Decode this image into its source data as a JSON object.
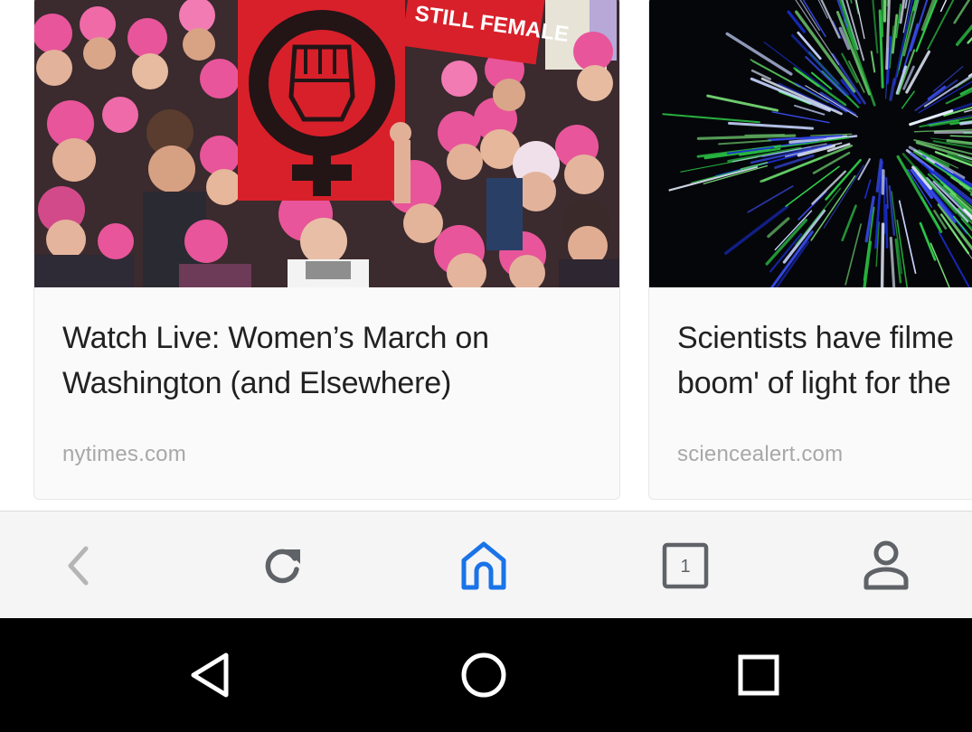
{
  "feed": {
    "cards": [
      {
        "title": "Watch Live: Women’s March on\nWashington (and Elsewhere)",
        "source": "nytimes.com",
        "image": "protest-crowd-photo",
        "sign_text": "STILL FEMALE"
      },
      {
        "title": "Scientists have filme\nboom' of light for the",
        "source": "sciencealert.com",
        "image": "light-speed-streaks-photo"
      }
    ]
  },
  "toolbar": {
    "buttons": [
      {
        "name": "back",
        "icon": "chevron-left-icon"
      },
      {
        "name": "reload",
        "icon": "reload-icon"
      },
      {
        "name": "home",
        "icon": "home-icon",
        "active": true
      },
      {
        "name": "tabs",
        "icon": "tabs-icon",
        "count": "1"
      },
      {
        "name": "profile",
        "icon": "person-icon"
      }
    ]
  },
  "navbar": {
    "buttons": [
      "back-triangle-icon",
      "home-circle-icon",
      "recents-square-icon"
    ]
  },
  "colors": {
    "accent": "#1a73e8",
    "icon": "#5f6368",
    "icon_disabled": "#b5b5b5",
    "text": "#212121",
    "source": "#a8a8a8",
    "sign_red": "#d8202a",
    "hat_pink": "#e8559a"
  }
}
